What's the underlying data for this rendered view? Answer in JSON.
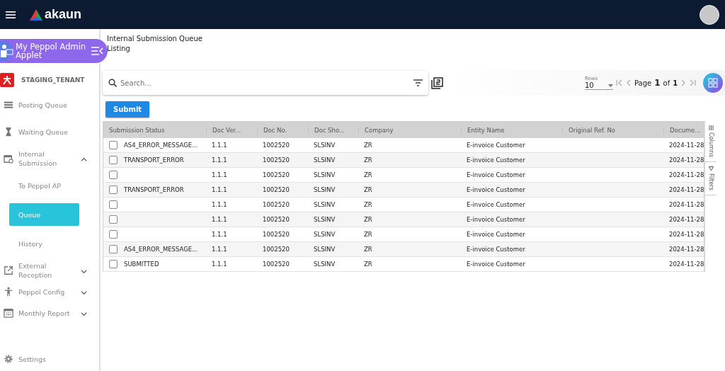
{
  "topbar": {
    "logo": "akaun"
  },
  "applet": {
    "title": "My Peppol Admin Applet",
    "tenant": "STAGING_TENANT"
  },
  "nav": [
    {
      "label": "Posting Queue"
    },
    {
      "label": "Waiting Queue"
    },
    {
      "label": "Internal Submission",
      "expanded": true,
      "children": [
        {
          "label": "To Peppol AP",
          "selected": false
        },
        {
          "label": "Queue",
          "selected": true
        },
        {
          "label": "History",
          "selected": false
        }
      ]
    },
    {
      "label": "External Reception",
      "expanded": false
    },
    {
      "label": "Peppol Config",
      "expanded": false
    },
    {
      "label": "Monthly Report",
      "expanded": false
    }
  ],
  "settings": {
    "label": "Settings"
  },
  "page": {
    "title": "Internal Submission Queue Listing"
  },
  "search": {
    "placeholder": "Search..."
  },
  "pagination": {
    "rows_label": "Rows",
    "rows": "10",
    "page_label": "Page",
    "page": "1",
    "of_label": "of",
    "total": "1"
  },
  "submit_button": "Submit",
  "table": {
    "columns": [
      "Submission Status",
      "Doc Ver...",
      "Doc No.",
      "Doc Sho...",
      "Company",
      "Entity Name",
      "Original Ref. No",
      "Docume..."
    ],
    "rows": [
      {
        "checked": false,
        "cells": [
          "AS4_ERROR_MESSAGE...",
          "1.1.1",
          "1002520",
          "SLSINV",
          "ZR",
          "E-invoice Customer",
          "",
          "2024-11-28"
        ]
      },
      {
        "checked": false,
        "cells": [
          "TRANSPORT_ERROR",
          "1.1.1",
          "1002520",
          "SLSINV",
          "ZR",
          "E-invoice Customer",
          "",
          "2024-11-28"
        ]
      },
      {
        "checked": false,
        "cells": [
          "",
          "1.1.1",
          "1002520",
          "SLSINV",
          "ZR",
          "E-invoice Customer",
          "",
          "2024-11-28"
        ]
      },
      {
        "checked": false,
        "cells": [
          "TRANSPORT_ERROR",
          "1.1.1",
          "1002520",
          "SLSINV",
          "ZR",
          "E-invoice Customer",
          "",
          "2024-11-28"
        ]
      },
      {
        "checked": false,
        "cells": [
          "",
          "1.1.1",
          "1002520",
          "SLSINV",
          "ZR",
          "E-invoice Customer",
          "",
          "2024-11-28"
        ]
      },
      {
        "checked": false,
        "cells": [
          "",
          "1.1.1",
          "1002520",
          "SLSINV",
          "ZR",
          "E-invoice Customer",
          "",
          "2024-11-28"
        ]
      },
      {
        "checked": false,
        "cells": [
          "",
          "1.1.1",
          "1002520",
          "SLSINV",
          "ZR",
          "E-invoice Customer",
          "",
          "2024-11-28"
        ]
      },
      {
        "checked": false,
        "cells": [
          "AS4_ERROR_MESSAGE...",
          "1.1.1",
          "1002520",
          "SLSINV",
          "ZR",
          "E-invoice Customer",
          "",
          "2024-11-28"
        ]
      },
      {
        "checked": false,
        "cells": [
          "SUBMITTED",
          "1.1.1",
          "1002520",
          "SLSINV",
          "ZR",
          "E-invoice Customer",
          "",
          "2024-11-28"
        ]
      }
    ]
  },
  "side_tabs": [
    "Columns",
    "Filters"
  ]
}
